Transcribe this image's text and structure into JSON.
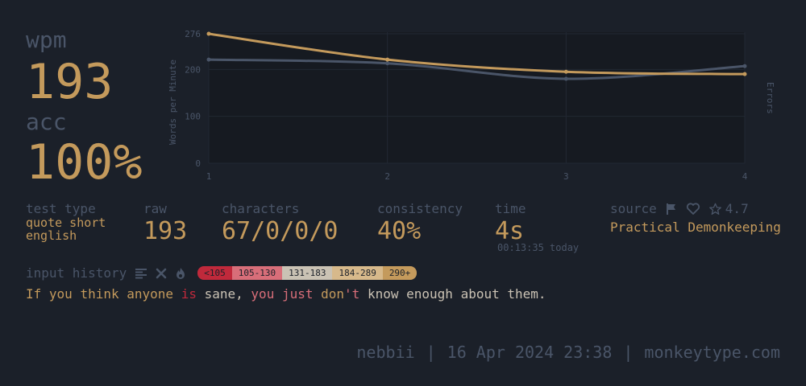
{
  "stats": {
    "wpm_label": "wpm",
    "wpm_value": "193",
    "acc_label": "acc",
    "acc_value": "100%"
  },
  "details": {
    "test_type_label": "test type",
    "test_type_value_1": "quote short",
    "test_type_value_2": "english",
    "raw_label": "raw",
    "raw_value": "193",
    "characters_label": "characters",
    "characters_value": "67/0/0/0",
    "consistency_label": "consistency",
    "consistency_value": "40%",
    "time_label": "time",
    "time_value": "4s",
    "time_sub": "00:13:35 today",
    "source_label": "source",
    "rating": "4.7",
    "source_value": "Practical Demonkeeping"
  },
  "history": {
    "label": "input history",
    "legend": [
      {
        "text": "<105",
        "color": "#c0293b"
      },
      {
        "text": "105-130",
        "color": "#d86e79"
      },
      {
        "text": "131-183",
        "color": "#cac2b4"
      },
      {
        "text": "184-289",
        "color": "#d7b98b"
      },
      {
        "text": "290+",
        "color": "#c49a5c"
      }
    ],
    "words": [
      {
        "text": "If",
        "kind": "main"
      },
      {
        "text": "you",
        "kind": "main"
      },
      {
        "text": "think",
        "kind": "main"
      },
      {
        "text": "anyone",
        "kind": "main"
      },
      {
        "text": "is",
        "kind": "err"
      },
      {
        "text": "sane,",
        "kind": "norm"
      },
      {
        "text": "you",
        "kind": "slow"
      },
      {
        "text": "just",
        "kind": "slow"
      },
      {
        "text": "don't",
        "kind": "mixed",
        "parts": [
          {
            "t": "don",
            "k": "main"
          },
          {
            "t": "'t",
            "k": "slow"
          }
        ]
      },
      {
        "text": "know",
        "kind": "norm"
      },
      {
        "text": "enough",
        "kind": "norm"
      },
      {
        "text": "about",
        "kind": "norm"
      },
      {
        "text": "them.",
        "kind": "norm"
      }
    ]
  },
  "footer": {
    "user": "nebbii",
    "date": "16 Apr 2024 23:38",
    "site": "monkeytype.com",
    "separator": "|"
  },
  "chart_data": {
    "type": "line",
    "x": [
      1,
      2,
      3,
      4
    ],
    "series": [
      {
        "values": [
          276,
          221,
          195,
          190
        ],
        "color": "#c49a5c"
      },
      {
        "values": [
          221,
          213,
          180,
          207
        ],
        "color": "#4a5568"
      }
    ],
    "ylabel": "Words per Minute",
    "y2label": "Errors",
    "yticks": [
      0,
      100,
      200,
      276
    ],
    "ylim": [
      0,
      276
    ],
    "xlim": [
      1,
      4
    ]
  }
}
